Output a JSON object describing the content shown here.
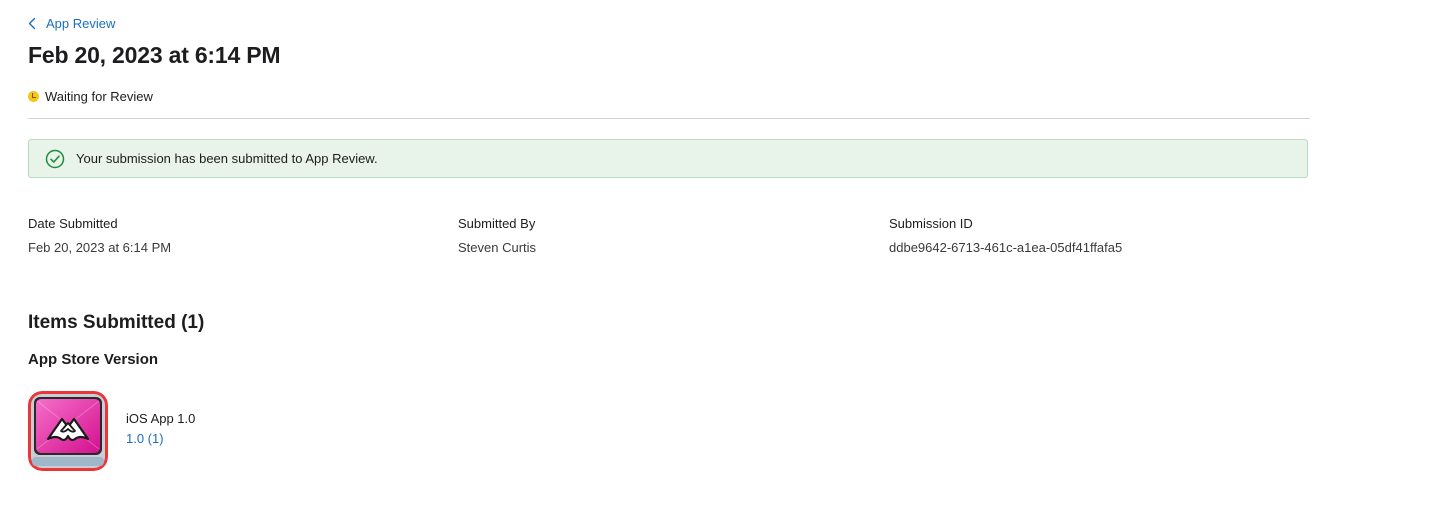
{
  "nav": {
    "back_label": "App Review"
  },
  "header": {
    "title": "Feb 20, 2023 at 6:14 PM",
    "status": "Waiting for Review"
  },
  "banner": {
    "message": "Your submission has been submitted to App Review."
  },
  "details": {
    "date_submitted_label": "Date Submitted",
    "date_submitted_value": "Feb 20, 2023 at 6:14 PM",
    "submitted_by_label": "Submitted By",
    "submitted_by_value": "Steven Curtis",
    "submission_id_label": "Submission ID",
    "submission_id_value": "ddbe9642-6713-461c-a1ea-05df41ffafa5"
  },
  "items": {
    "title": "Items Submitted (1)",
    "group_title": "App Store Version",
    "app": {
      "name": "iOS App 1.0",
      "version": "1.0 (1)"
    }
  },
  "colors": {
    "link": "#1a6fc4",
    "status_pending": "#f5c518",
    "success_bg": "#e8f3ea",
    "success_icon": "#1e8e3e"
  }
}
